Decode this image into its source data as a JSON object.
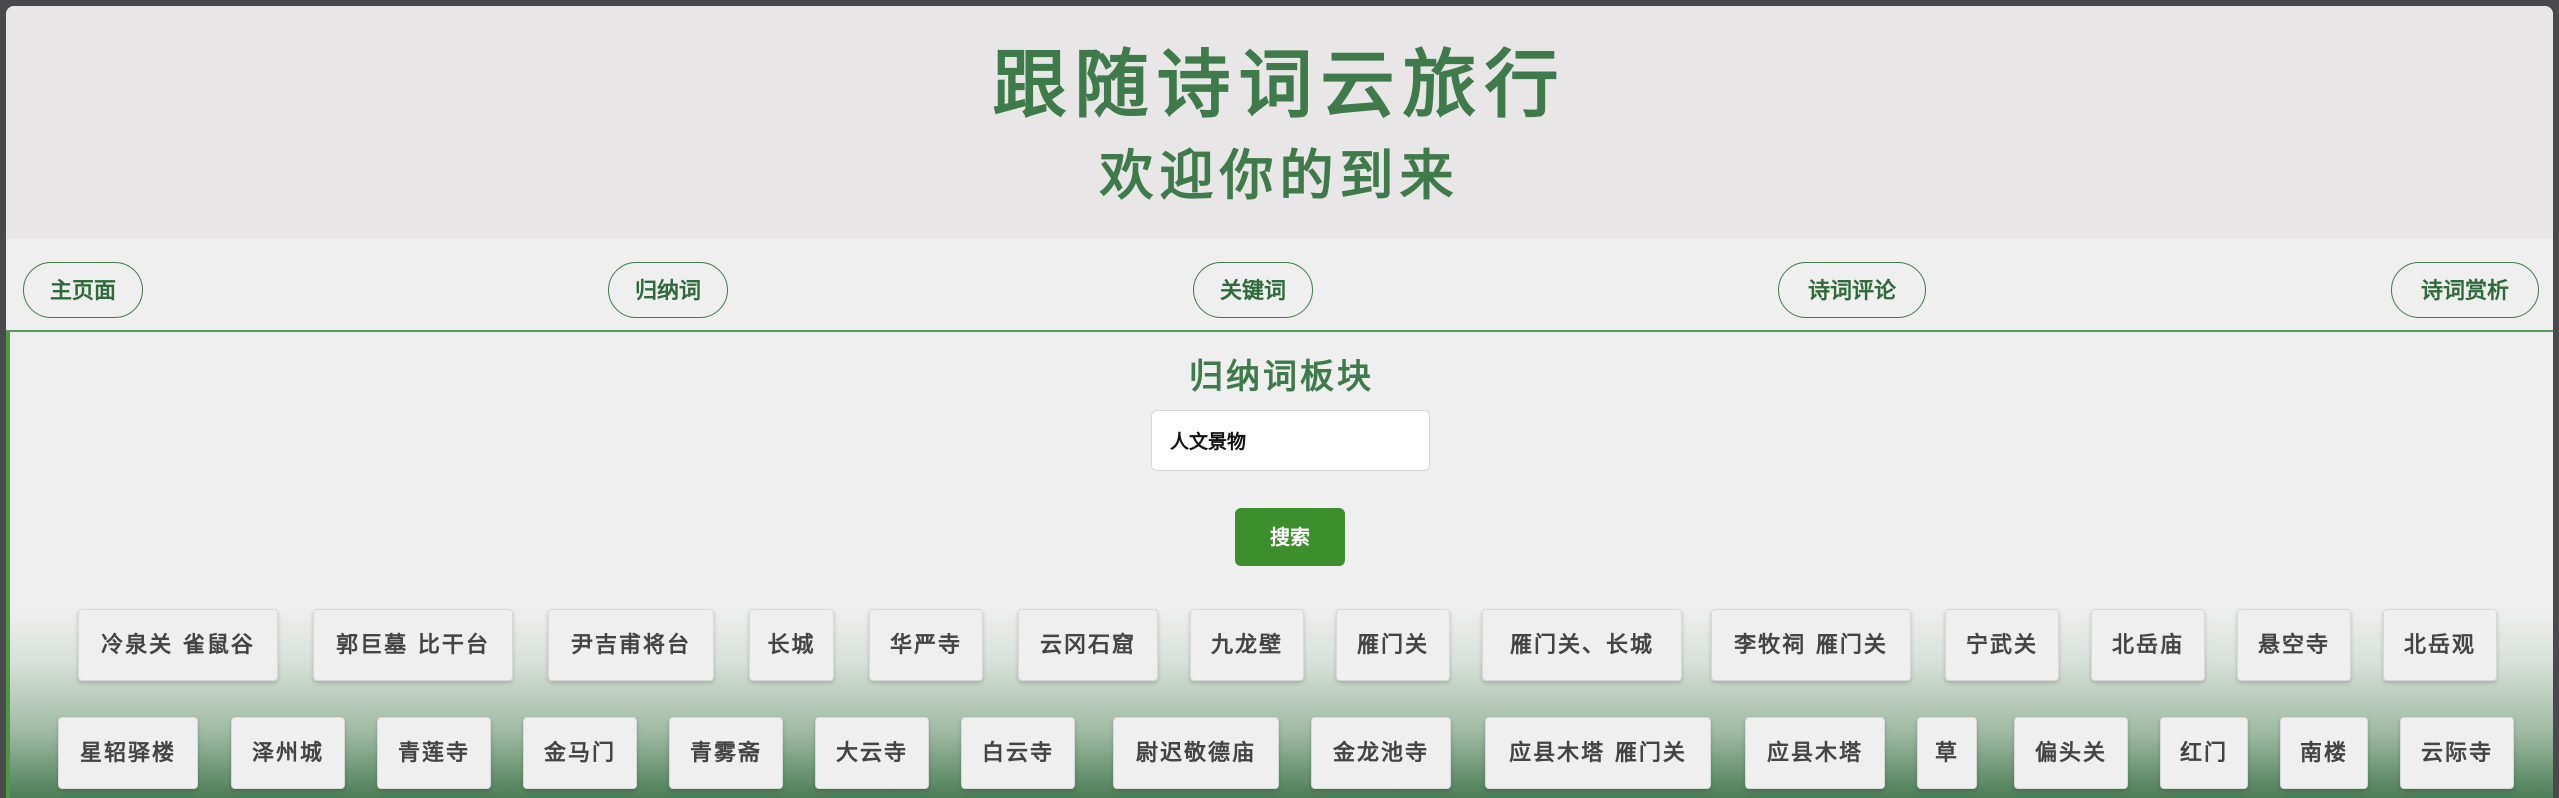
{
  "header": {
    "title": "跟随诗词云旅行",
    "subtitle": "欢迎你的到来"
  },
  "nav": {
    "items": [
      {
        "label": "主页面"
      },
      {
        "label": "归纳词"
      },
      {
        "label": "关键词"
      },
      {
        "label": "诗词评论"
      },
      {
        "label": "诗词赏析"
      }
    ]
  },
  "main": {
    "section_title": "归纳词板块",
    "search": {
      "value": "人文景物",
      "button_label": "搜索"
    },
    "tags_row1": [
      "冷泉关 雀鼠谷",
      "郭巨墓 比干台",
      "尹吉甫将台",
      "长城",
      "华严寺",
      "云冈石窟",
      "九龙壁",
      "雁门关",
      "雁门关、长城",
      "李牧祠 雁门关",
      "宁武关",
      "北岳庙",
      "悬空寺",
      "北岳观"
    ],
    "tags_row2": [
      "星轺驿楼",
      "泽州城",
      "青莲寺",
      "金马门",
      "青雾斋",
      "大云寺",
      "白云寺",
      "尉迟敬德庙",
      "金龙池寺",
      "应县木塔 雁门关",
      "应县木塔",
      "草",
      "偏头关",
      "红门",
      "南楼",
      "云际寺"
    ]
  }
}
